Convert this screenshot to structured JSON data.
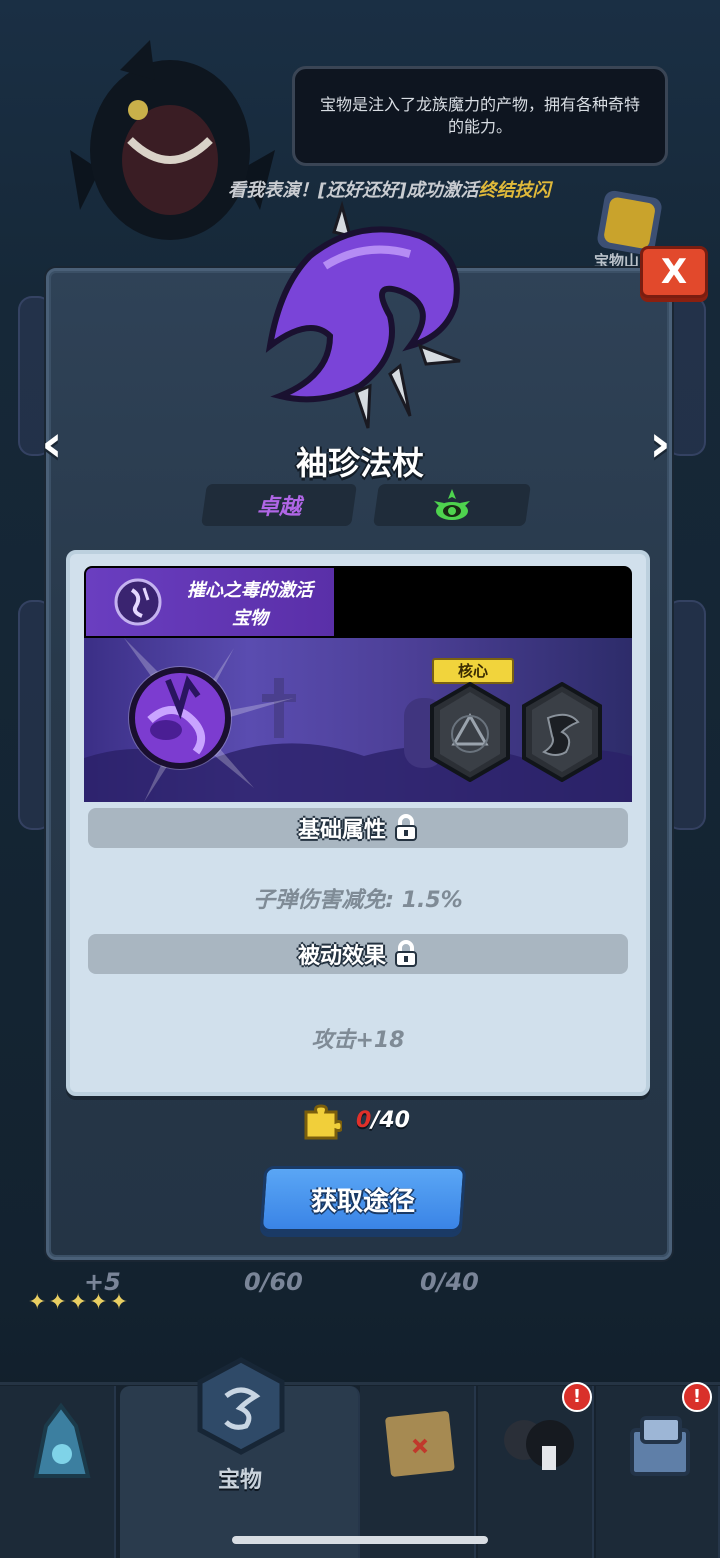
{
  "background": {
    "tooltip_text": "宝物是注入了龙族魔力的产物，拥有各种奇特的能力。",
    "marquee_prefix": "看我表演！[还好还好]成功激活",
    "marquee_highlight": "终结技闪",
    "shop_label": "宝物山",
    "behind_modal_counts": [
      "+5",
      "0/60",
      "0/40"
    ]
  },
  "modal": {
    "close_label": "X",
    "prev_label": "‹",
    "next_label": "›",
    "item_name": "袖珍法杖",
    "rarity": "卓越",
    "set": {
      "name_line1": "摧心之毒的激活",
      "name_line2": "宝物"
    },
    "core_label": "核心",
    "sections": {
      "base_title": "基础属性",
      "base_stat": "子弹伤害减免: 1.5%",
      "passive_title": "被动效果",
      "passive_stat": "攻击+18"
    },
    "fragments": {
      "current": "0",
      "total": "/40"
    },
    "action_label": "获取途径"
  },
  "bottom_nav": {
    "active_label": "宝物",
    "tabs": [
      "crystal-tab",
      "treasure-tab",
      "map-tab",
      "hero-tab",
      "shop-tab"
    ]
  },
  "colors": {
    "rarity": "#b066e6",
    "accent_purple": "#6a3ec0",
    "action_blue": "#3a84e6",
    "close_red": "#e2492c"
  }
}
